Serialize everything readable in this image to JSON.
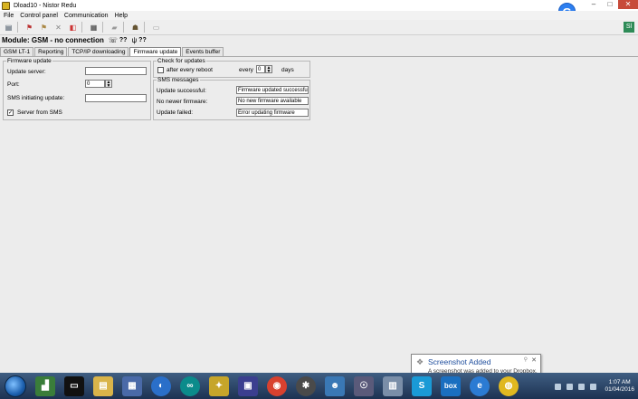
{
  "window": {
    "title": "Dload10 - Nistor Redu"
  },
  "menu": [
    "File",
    "Control panel",
    "Communication",
    "Help"
  ],
  "module": {
    "label": "Module: GSM - no connection",
    "q1": "??",
    "q2": "??"
  },
  "tabs": [
    {
      "label": "GSM LT-1",
      "active": false
    },
    {
      "label": "Reporting",
      "active": false
    },
    {
      "label": "TCP/IP downloading",
      "active": false
    },
    {
      "label": "Firmware update",
      "active": true
    },
    {
      "label": "Events buffer",
      "active": false
    }
  ],
  "firmware": {
    "legend": "Firmware update",
    "update_server_label": "Update server:",
    "update_server_value": "",
    "port_label": "Port:",
    "port_value": "0",
    "sms_label": "SMS initiating update:",
    "sms_value": "",
    "server_sms_label": "Server from SMS",
    "server_sms_checked": "✓"
  },
  "check": {
    "legend": "Check for updates",
    "after_reboot_label": "after every reboot",
    "every_label": "every",
    "every_value": "0",
    "days_label": "days"
  },
  "sms": {
    "legend": "SMS messages",
    "rows": [
      {
        "label": "Update successful:",
        "value": "Firmware updated successful"
      },
      {
        "label": "No newer firmware:",
        "value": "No new firmware available"
      },
      {
        "label": "Update failed:",
        "value": "Error updating firmware"
      }
    ]
  },
  "notification": {
    "title": "Screenshot Added",
    "body": "A screenshot was added to your Dropbox."
  },
  "clock": {
    "time": "1:07 AM",
    "date": "01/04/2016"
  },
  "taskbar_apps": [
    "chart",
    "terminal",
    "explorer",
    "network",
    "browser-q",
    "arduino",
    "tools",
    "save",
    "chrome",
    "settings",
    "people",
    "remote",
    "calc",
    "skype",
    "box",
    "ie",
    "globe"
  ],
  "colors": {
    "accent": "#1f4e9d",
    "close": "#c74a3a"
  }
}
